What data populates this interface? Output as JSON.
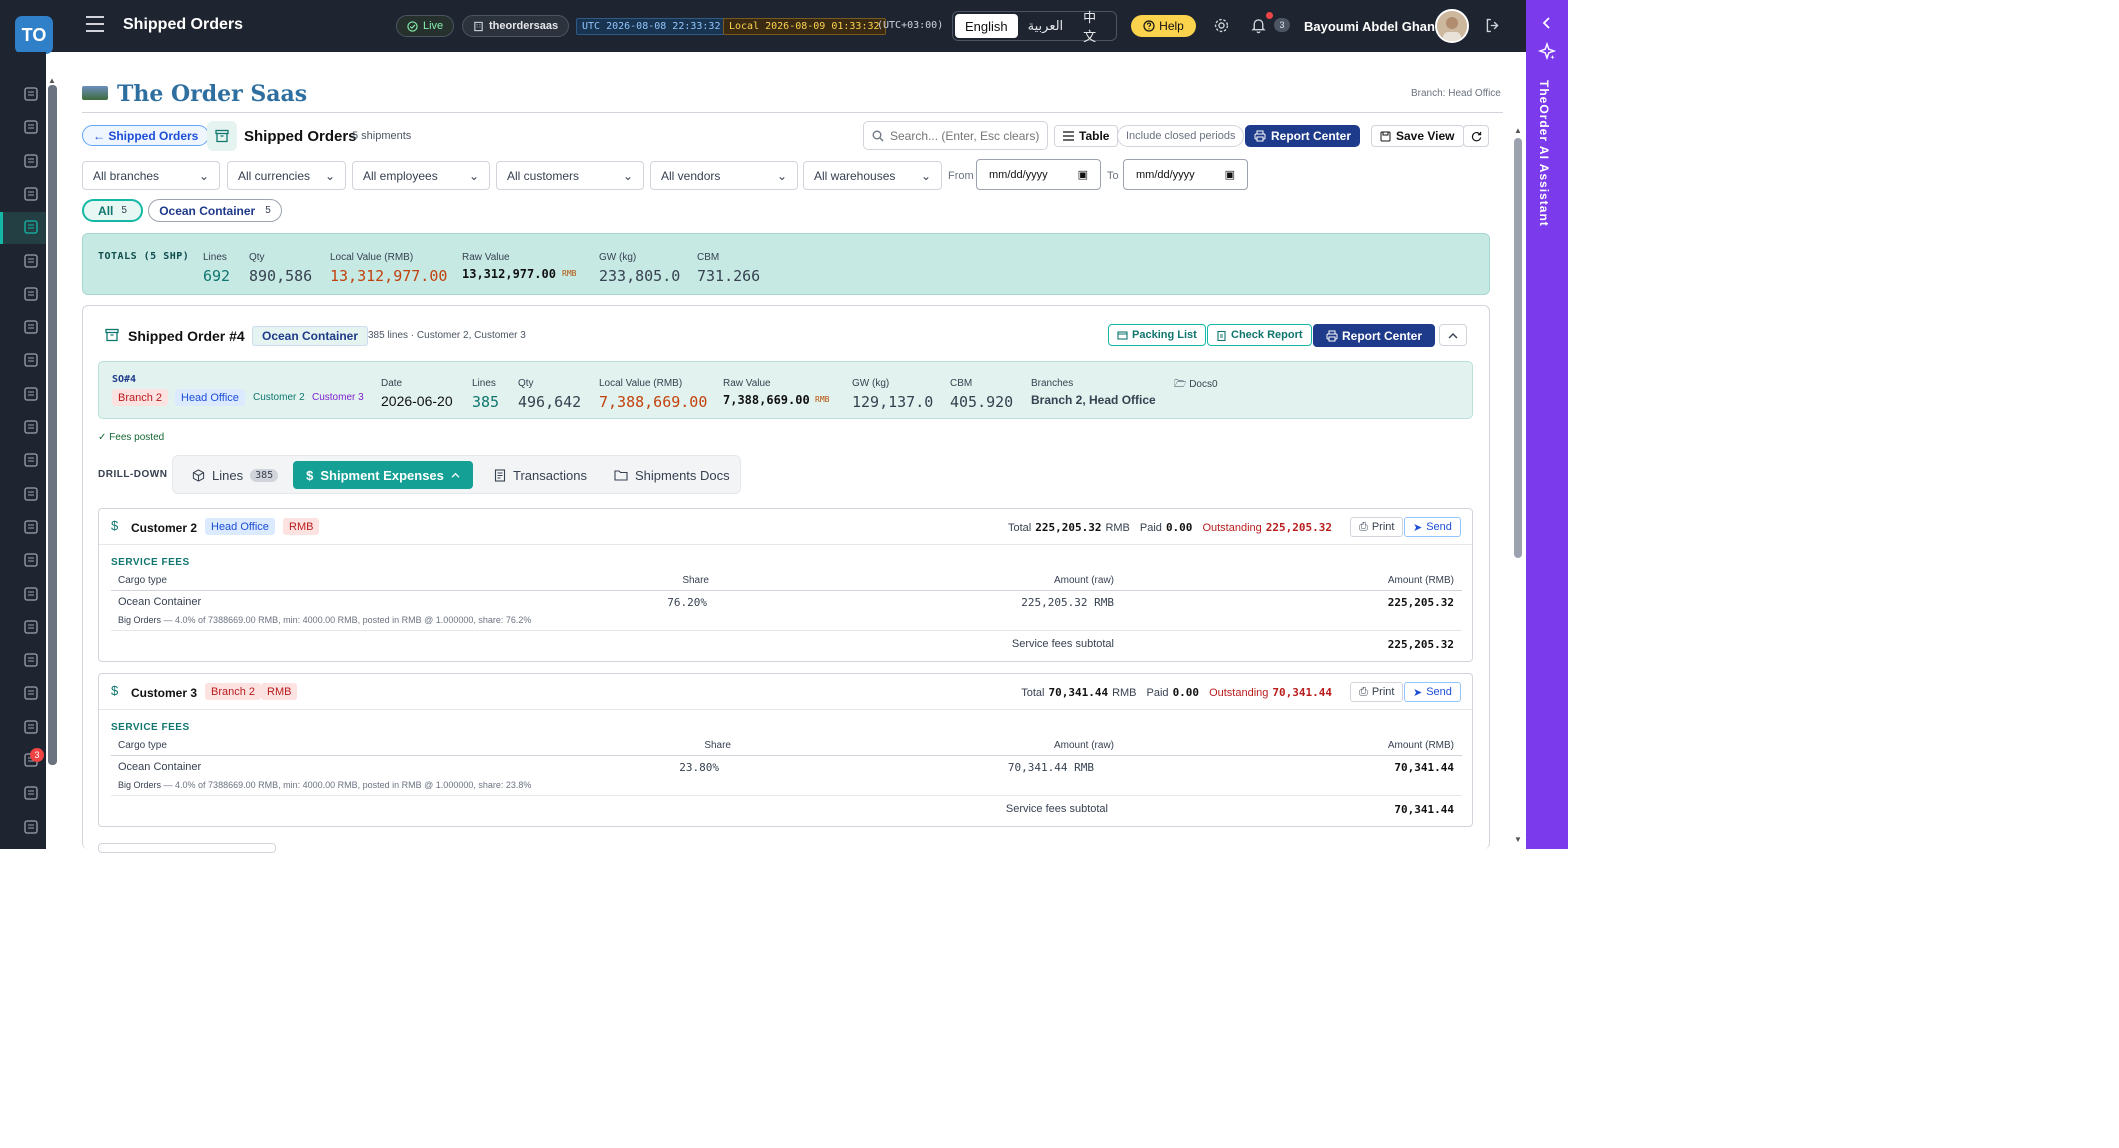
{
  "topbar": {
    "logo_text": "TO",
    "title": "Shipped Orders",
    "live_label": "Live",
    "tenant": "theordersaas",
    "utc_clock": "UTC 2026-08-08 22:33:32",
    "local_clock": "Local 2026-08-09 01:33:32",
    "timezone": "(UTC+03:00)",
    "languages": [
      "English",
      "العربية",
      "中文"
    ],
    "active_language": "English",
    "help_label": "Help",
    "notifications_count": "3",
    "user_name": "Bayoumi Abdel Ghani"
  },
  "sidebar": {
    "icons": [
      "dashboard-icon",
      "clipboard-icon",
      "cart-icon",
      "checklist-icon",
      "archive-icon",
      "box-icon",
      "layers-icon",
      "users-icon",
      "id-card-icon",
      "accessibility-icon",
      "car-icon",
      "invoice-icon",
      "wallet-icon",
      "bank-icon",
      "document-icon",
      "book-icon",
      "dollar-icon",
      "chart-icon",
      "finance-icon",
      "inbox-icon",
      "send-icon",
      "team-icon",
      "calendar-icon"
    ],
    "active_index": 4,
    "badge_count": "3"
  },
  "ai_panel": {
    "title": "TheOrder AI Assistant"
  },
  "brand": {
    "name": "The Order Saas",
    "branch_label": "Branch: Head Office"
  },
  "page": {
    "back_label": "← Shipped Orders",
    "title": "Shipped Orders",
    "subtitle": "5 shipments"
  },
  "toolbar": {
    "search_placeholder": "Search... (Enter, Esc clears)",
    "table_label": "Table",
    "include_closed_label": "Include closed periods",
    "report_center_label": "Report Center",
    "save_view_label": "Save View"
  },
  "filters": {
    "branches": "All branches",
    "currencies": "All currencies",
    "employees": "All employees",
    "customers": "All customers",
    "vendors": "All vendors",
    "warehouses": "All warehouses",
    "from_label": "From",
    "to_label": "To",
    "date_placeholder": "mm/dd/yyyy"
  },
  "chips": [
    {
      "label": "All",
      "count": "5"
    },
    {
      "label": "Ocean Container",
      "count": "5"
    }
  ],
  "totals": {
    "title": "TOTALS (5 SHP)",
    "lines_label": "Lines",
    "lines": "692",
    "qty_label": "Qty",
    "qty": "890,586",
    "local_label": "Local Value (RMB)",
    "local": "13,312,977.00",
    "raw_label": "Raw Value",
    "raw": "13,312,977.00",
    "raw_ccy": "RMB",
    "gw_label": "GW (kg)",
    "gw": "233,805.0",
    "cbm_label": "CBM",
    "cbm": "731.266"
  },
  "order": {
    "title": "Shipped Order #4",
    "type": "Ocean Container",
    "subtitle": "385 lines · Customer 2, Customer 3",
    "packing_list_label": "Packing List",
    "check_report_label": "Check Report",
    "report_center_label": "Report Center",
    "so": "SO#4",
    "tags": [
      "Branch 2",
      "Head Office",
      "Customer 2",
      "Customer 3"
    ],
    "date_label": "Date",
    "date": "2026-06-20",
    "lines_label": "Lines",
    "lines": "385",
    "qty_label": "Qty",
    "qty": "496,642",
    "local_label": "Local Value (RMB)",
    "local": "7,388,669.00",
    "raw_label": "Raw Value",
    "raw": "7,388,669.00",
    "raw_ccy": "RMB",
    "gw_label": "GW (kg)",
    "gw": "129,137.0",
    "cbm_label": "CBM",
    "cbm": "405.920",
    "branches_label": "Branches",
    "branches": "Branch 2, Head Office",
    "docs_label": "Docs",
    "docs_count": "0",
    "fees_posted": "✓ Fees posted"
  },
  "drilldown": {
    "label": "DRILL-DOWN",
    "tabs": [
      {
        "label": "Lines",
        "count": "385"
      },
      {
        "label": "Shipment Expenses"
      },
      {
        "label": "Transactions"
      },
      {
        "label": "Shipments Docs"
      }
    ]
  },
  "expenses": [
    {
      "customer": "Customer 2",
      "branch": "Head Office",
      "currency": "RMB",
      "total_label": "Total",
      "total": "225,205.32",
      "total_ccy": "RMB",
      "paid_label": "Paid",
      "paid": "0.00",
      "outstanding_label": "Outstanding",
      "outstanding": "225,205.32",
      "print_label": "Print",
      "send_label": "Send",
      "section": "SERVICE FEES",
      "headers": [
        "Cargo type",
        "Share",
        "Amount (raw)",
        "Amount (RMB)"
      ],
      "row": {
        "cargo": "Ocean Container",
        "share": "76.20%",
        "raw": "225,205.32 RMB",
        "rmb": "225,205.32"
      },
      "note_title": "Big Orders",
      "note": "— 4.0% of 7388669.00 RMB, min: 4000.00 RMB, posted in RMB @ 1.000000, share: 76.2%",
      "subtotal_label": "Service fees subtotal",
      "subtotal": "225,205.32"
    },
    {
      "customer": "Customer 3",
      "branch": "Branch 2",
      "currency": "RMB",
      "total_label": "Total",
      "total": "70,341.44",
      "total_ccy": "RMB",
      "paid_label": "Paid",
      "paid": "0.00",
      "outstanding_label": "Outstanding",
      "outstanding": "70,341.44",
      "print_label": "Print",
      "send_label": "Send",
      "section": "SERVICE FEES",
      "headers": [
        "Cargo type",
        "Share",
        "Amount (raw)",
        "Amount (RMB)"
      ],
      "row": {
        "cargo": "Ocean Container",
        "share": "23.80%",
        "raw": "70,341.44 RMB",
        "rmb": "70,341.44"
      },
      "note_title": "Big Orders",
      "note": "— 4.0% of 7388669.00 RMB, min: 4000.00 RMB, posted in RMB @ 1.000000, share: 23.8%",
      "subtotal_label": "Service fees subtotal",
      "subtotal": "70,341.44"
    }
  ]
}
